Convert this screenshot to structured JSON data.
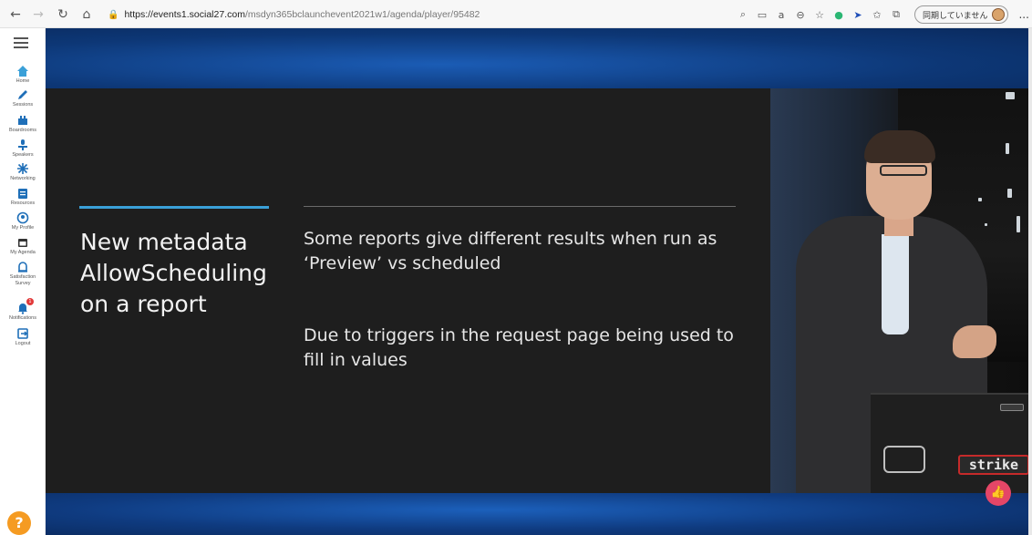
{
  "browser": {
    "url_host": "https://events1.social27.com",
    "url_path": "/msdyn365bclaunchevent2021w1/agenda/player/95482",
    "sync_label": "同期していません",
    "more_label": "..."
  },
  "sidebar": {
    "items": [
      {
        "label": "Home",
        "icon": "home-icon",
        "color": "#3aa0d8"
      },
      {
        "label": "Sessions",
        "icon": "pencil-icon",
        "color": "#1f6fb8"
      },
      {
        "label": "Boardrooms",
        "icon": "boardroom-icon",
        "color": "#1f6fb8"
      },
      {
        "label": "Speakers",
        "icon": "speaker-icon",
        "color": "#1f6fb8"
      },
      {
        "label": "Networking",
        "icon": "networking-icon",
        "color": "#1f6fb8"
      },
      {
        "label": "Resources",
        "icon": "resources-icon",
        "color": "#1f6fb8"
      },
      {
        "label": "My Profile",
        "icon": "profile-icon",
        "color": "#1f6fb8"
      },
      {
        "label": "My Agenda",
        "icon": "calendar-icon",
        "color": "#333333"
      },
      {
        "label": "Satisfaction Survey",
        "icon": "survey-icon",
        "color": "#1f6fb8"
      },
      {
        "label": "Notifications",
        "icon": "bell-icon",
        "color": "#1f6fb8",
        "badge": "1"
      },
      {
        "label": "Logout",
        "icon": "logout-icon",
        "color": "#1f6fb8"
      }
    ],
    "help_label": "?"
  },
  "slide": {
    "title": "New metadata AllowScheduling on a report",
    "bullets": [
      "Some reports give different results when run as ‘Preview’ vs scheduled",
      "Due to triggers in the request page being used to fill in values"
    ]
  },
  "camera": {
    "laptop_sticker": "strike"
  },
  "like_button": {
    "icon": "thumbs-up-icon",
    "color": "#e54667"
  }
}
